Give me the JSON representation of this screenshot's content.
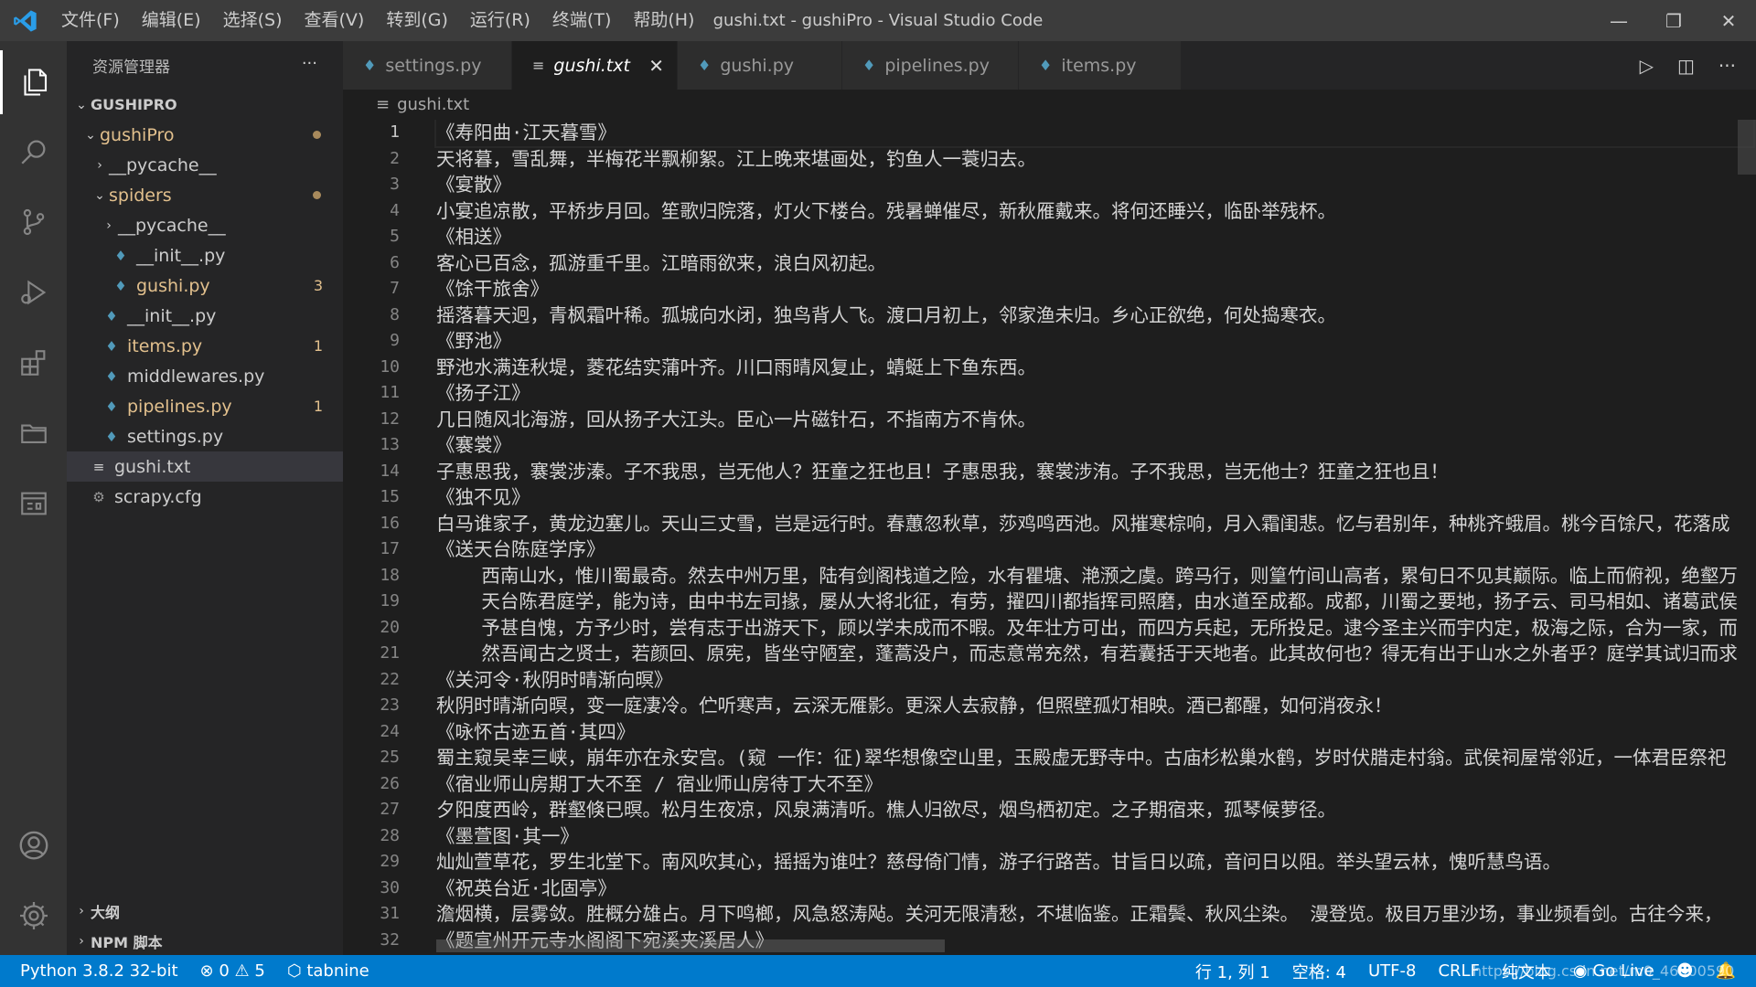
{
  "window": {
    "title": "gushi.txt - gushiPro - Visual Studio Code"
  },
  "menu": [
    "文件(F)",
    "编辑(E)",
    "选择(S)",
    "查看(V)",
    "转到(G)",
    "运行(R)",
    "终端(T)",
    "帮助(H)"
  ],
  "sidebar": {
    "title": "资源管理器",
    "more": "···",
    "root": "GUSHIPRO",
    "tree": [
      {
        "label": "gushiPro",
        "depth": 1,
        "kind": "folder-open",
        "modified": true,
        "dot": true
      },
      {
        "label": "__pycache__",
        "depth": 2,
        "kind": "folder-closed"
      },
      {
        "label": "spiders",
        "depth": 2,
        "kind": "folder-open",
        "modified": true,
        "dot": true
      },
      {
        "label": "__pycache__",
        "depth": 3,
        "kind": "folder-closed"
      },
      {
        "label": "__init__.py",
        "depth": 3,
        "kind": "python"
      },
      {
        "label": "gushi.py",
        "depth": 3,
        "kind": "python",
        "modified": true,
        "badge": "3"
      },
      {
        "label": "__init__.py",
        "depth": 2,
        "kind": "python"
      },
      {
        "label": "items.py",
        "depth": 2,
        "kind": "python",
        "modified": true,
        "badge": "1"
      },
      {
        "label": "middlewares.py",
        "depth": 2,
        "kind": "python"
      },
      {
        "label": "pipelines.py",
        "depth": 2,
        "kind": "python",
        "modified": true,
        "badge": "1"
      },
      {
        "label": "settings.py",
        "depth": 2,
        "kind": "python"
      },
      {
        "label": "gushi.txt",
        "depth": 1,
        "kind": "text",
        "selected": true
      },
      {
        "label": "scrapy.cfg",
        "depth": 1,
        "kind": "config"
      }
    ],
    "outline": "大纲",
    "npm": "NPM 脚本"
  },
  "tabs": [
    {
      "label": "settings.py",
      "icon": "python-icon"
    },
    {
      "label": "gushi.txt",
      "icon": "text-file-icon",
      "active": true
    },
    {
      "label": "gushi.py",
      "icon": "python-icon"
    },
    {
      "label": "pipelines.py",
      "icon": "python-icon"
    },
    {
      "label": "items.py",
      "icon": "python-icon"
    }
  ],
  "breadcrumb": "gushi.txt",
  "editor": {
    "current_line": 1,
    "lines": [
      "《寿阳曲·江天暮雪》",
      "天将暮，雪乱舞，半梅花半飘柳絮。江上晚来堪画处，钓鱼人一蓑归去。",
      "《宴散》",
      "小宴追凉散，平桥步月回。笙歌归院落，灯火下楼台。残暑蝉催尽，新秋雁戴来。将何还睡兴，临卧举残杯。",
      "《相送》",
      "客心已百念，孤游重千里。江暗雨欲来，浪白风初起。",
      "《馀干旅舍》",
      "摇落暮天迥，青枫霜叶稀。孤城向水闭，独鸟背人飞。渡口月初上，邻家渔未归。乡心正欲绝，何处捣寒衣。",
      "《野池》",
      "野池水满连秋堤，菱花结实蒲叶齐。川口雨晴风复止，蜻蜓上下鱼东西。",
      "《扬子江》",
      "几日随风北海游，回从扬子大江头。臣心一片磁针石，不指南方不肯休。",
      "《褰裳》",
      "子惠思我，褰裳涉溱。子不我思，岂无他人？狂童之狂也且！子惠思我，褰裳涉洧。子不我思，岂无他士？狂童之狂也且！",
      "《独不见》",
      "白马谁家子，黄龙边塞儿。天山三丈雪，岂是远行时。春蕙忽秋草，莎鸡鸣西池。风摧寒棕响，月入霜闺悲。忆与君别年，种桃齐蛾眉。桃今百馀尺，花落成",
      "《送天台陈庭学序》",
      "    西南山水，惟川蜀最奇。然去中州万里，陆有剑阁栈道之险，水有瞿塘、滟滪之虞。跨马行，则篁竹间山高者，累旬日不见其巅际。临上而俯视，绝壑万",
      "    天台陈君庭学，能为诗，由中书左司掾，屡从大将北征，有劳，擢四川都指挥司照磨，由水道至成都。成都，川蜀之要地，扬子云、司马相如、诸葛武侯",
      "    予甚自愧，方予少时，尝有志于出游天下，顾以学未成而不暇。及年壮方可出，而四方兵起，无所投足。逮今圣主兴而宇内定，极海之际，合为一家，而",
      "    然吾闻古之贤士，若颜回、原宪，皆坐守陋室，蓬蒿没户，而志意常充然，有若囊括于天地者。此其故何也？得无有出于山水之外者乎？庭学其试归而求",
      "《关河令·秋阴时晴渐向暝》",
      "秋阴时晴渐向暝，变一庭凄冷。伫听寒声，云深无雁影。更深人去寂静，但照壁孤灯相映。酒已都醒，如何消夜永！",
      "《咏怀古迹五首·其四》",
      "蜀主窥吴幸三峡，崩年亦在永安宫。(窥 一作：征)翠华想像空山里，玉殿虚无野寺中。古庙杉松巢水鹤，岁时伏腊走村翁。武侯祠屋常邻近，一体君臣祭祀",
      "《宿业师山房期丁大不至 / 宿业师山房待丁大不至》",
      "夕阳度西岭，群壑倏已暝。松月生夜凉，风泉满清听。樵人归欲尽，烟鸟栖初定。之子期宿来，孤琴候萝径。",
      "《墨萱图·其一》",
      "灿灿萱草花，罗生北堂下。南风吹其心，摇摇为谁吐？慈母倚门情，游子行路苦。甘旨日以疏，音问日以阻。举头望云林，愧听慧鸟语。",
      "《祝英台近·北固亭》",
      "澹烟横，层雾敛。胜概分雄占。月下鸣榔，风急怒涛飐。关河无限清愁，不堪临鉴。正霜鬓、秋风尘染。 漫登览。极目万里沙场，事业频看剑。古往今来，",
      "《题宣州开元寺水阁阁下宛溪夹溪居人》"
    ]
  },
  "statusbar": {
    "python": "Python 3.8.2 32-bit",
    "errors": "0",
    "warnings": "5",
    "tabnine": "tabnine",
    "position": "行 1, 列 1",
    "spaces": "空格: 4",
    "encoding": "UTF-8",
    "eol": "CRLF",
    "language": "纯文本",
    "golive": "Go Live",
    "watermark": "https://blog.csdn.net/m0_46500590"
  },
  "colors": {
    "accent": "#007acc",
    "modified": "#e2c08d",
    "python": "#519aba"
  }
}
